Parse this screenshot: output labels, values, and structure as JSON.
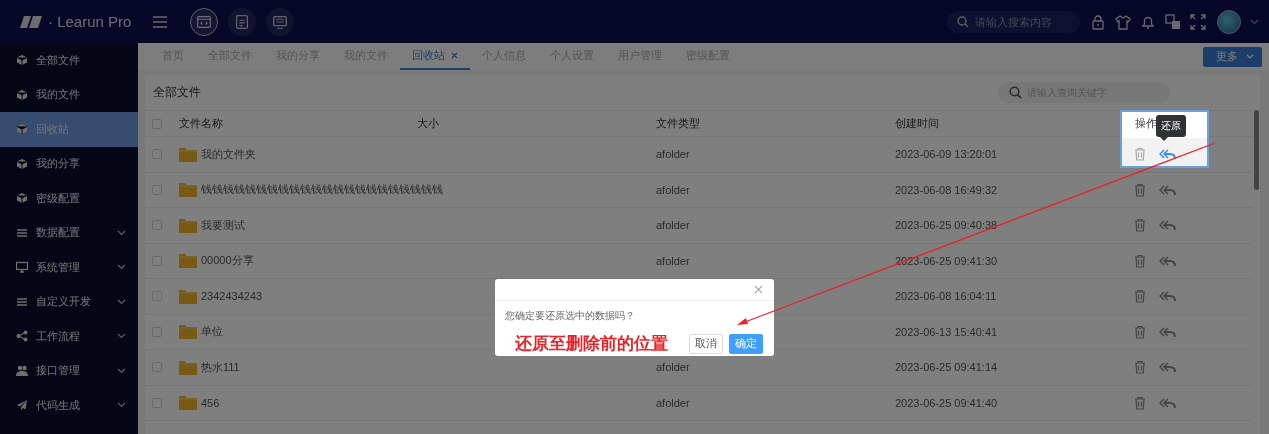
{
  "header": {
    "brand": "· Learun Pro",
    "apps": [
      {
        "kind": "code",
        "selected": true
      },
      {
        "kind": "document",
        "selected": false
      },
      {
        "kind": "monitor",
        "selected": false
      }
    ],
    "search": {
      "placeholder": "请输入搜索内容"
    }
  },
  "sidebar": {
    "items": [
      {
        "label": "全部文件",
        "kind": "cube",
        "selected": false,
        "expandable": false
      },
      {
        "label": "我的文件",
        "kind": "cube",
        "selected": false,
        "expandable": false
      },
      {
        "label": "回收站",
        "kind": "cube",
        "selected": true,
        "expandable": false
      },
      {
        "label": "我的分享",
        "kind": "cube",
        "selected": false,
        "expandable": false
      },
      {
        "label": "密级配置",
        "kind": "cube",
        "selected": false,
        "expandable": false
      },
      {
        "label": "数据配置",
        "kind": "list",
        "selected": false,
        "expandable": true
      },
      {
        "label": "系统管理",
        "kind": "monitor",
        "selected": false,
        "expandable": true
      },
      {
        "label": "自定义开发",
        "kind": "list",
        "selected": false,
        "expandable": true
      },
      {
        "label": "工作流程",
        "kind": "share",
        "selected": false,
        "expandable": true
      },
      {
        "label": "接口管理",
        "kind": "people",
        "selected": false,
        "expandable": true
      },
      {
        "label": "代码生成",
        "kind": "plane",
        "selected": false,
        "expandable": true
      }
    ]
  },
  "tabs": [
    {
      "label": "首页",
      "selected": false,
      "closable": false
    },
    {
      "label": "全部文件",
      "selected": false,
      "closable": false
    },
    {
      "label": "我的分享",
      "selected": false,
      "closable": false
    },
    {
      "label": "我的文件",
      "selected": false,
      "closable": false
    },
    {
      "label": "回收站",
      "selected": true,
      "closable": true
    },
    {
      "label": "个人信息",
      "selected": false,
      "closable": false
    },
    {
      "label": "个人设置",
      "selected": false,
      "closable": false
    },
    {
      "label": "用户管理",
      "selected": false,
      "closable": false
    },
    {
      "label": "密级配置",
      "selected": false,
      "closable": false
    }
  ],
  "more_button": "更多",
  "panel": {
    "title": "全部文件",
    "search": {
      "placeholder": "请输入查询关键字"
    }
  },
  "table": {
    "all_checked": false,
    "columns": [
      "文件名称",
      "大小",
      "文件类型",
      "创建时间",
      "操作"
    ],
    "rows": [
      {
        "checked": false,
        "name": "我的文件夹",
        "type": "afolder",
        "created": "2023-06-09 13:20:01",
        "highlighted": true,
        "tooltip": "还原"
      },
      {
        "checked": false,
        "name": "钱钱钱钱钱钱钱钱钱钱钱钱钱钱钱钱钱钱钱钱钱钱",
        "type": "afolder",
        "created": "2023-06-08 16:49:32",
        "highlighted": false
      },
      {
        "checked": false,
        "name": "我要测试",
        "type": "afolder",
        "created": "2023-06-25 09:40:38",
        "highlighted": false
      },
      {
        "checked": false,
        "name": "00000分享",
        "type": "afolder",
        "created": "2023-06-25 09:41:30",
        "highlighted": false
      },
      {
        "checked": false,
        "name": "2342434243",
        "created": "2023-06-08 16:04:11",
        "highlighted": false
      },
      {
        "checked": false,
        "name": "单位",
        "created": "2023-06-13 15:40:41",
        "highlighted": false
      },
      {
        "checked": false,
        "name": "热水111",
        "type": "afolder",
        "created": "2023-06-25 09:41:14",
        "highlighted": false
      },
      {
        "checked": false,
        "name": "456",
        "type": "afolder",
        "created": "2023-06-25 09:41:40",
        "highlighted": false
      }
    ]
  },
  "dialog": {
    "open": true,
    "message": "您确定要还原选中的数据吗？",
    "callout": "还原至删除前的位置",
    "buttons": [
      {
        "label": "取消",
        "kind": "default"
      },
      {
        "label": "确定",
        "kind": "primary"
      }
    ]
  }
}
